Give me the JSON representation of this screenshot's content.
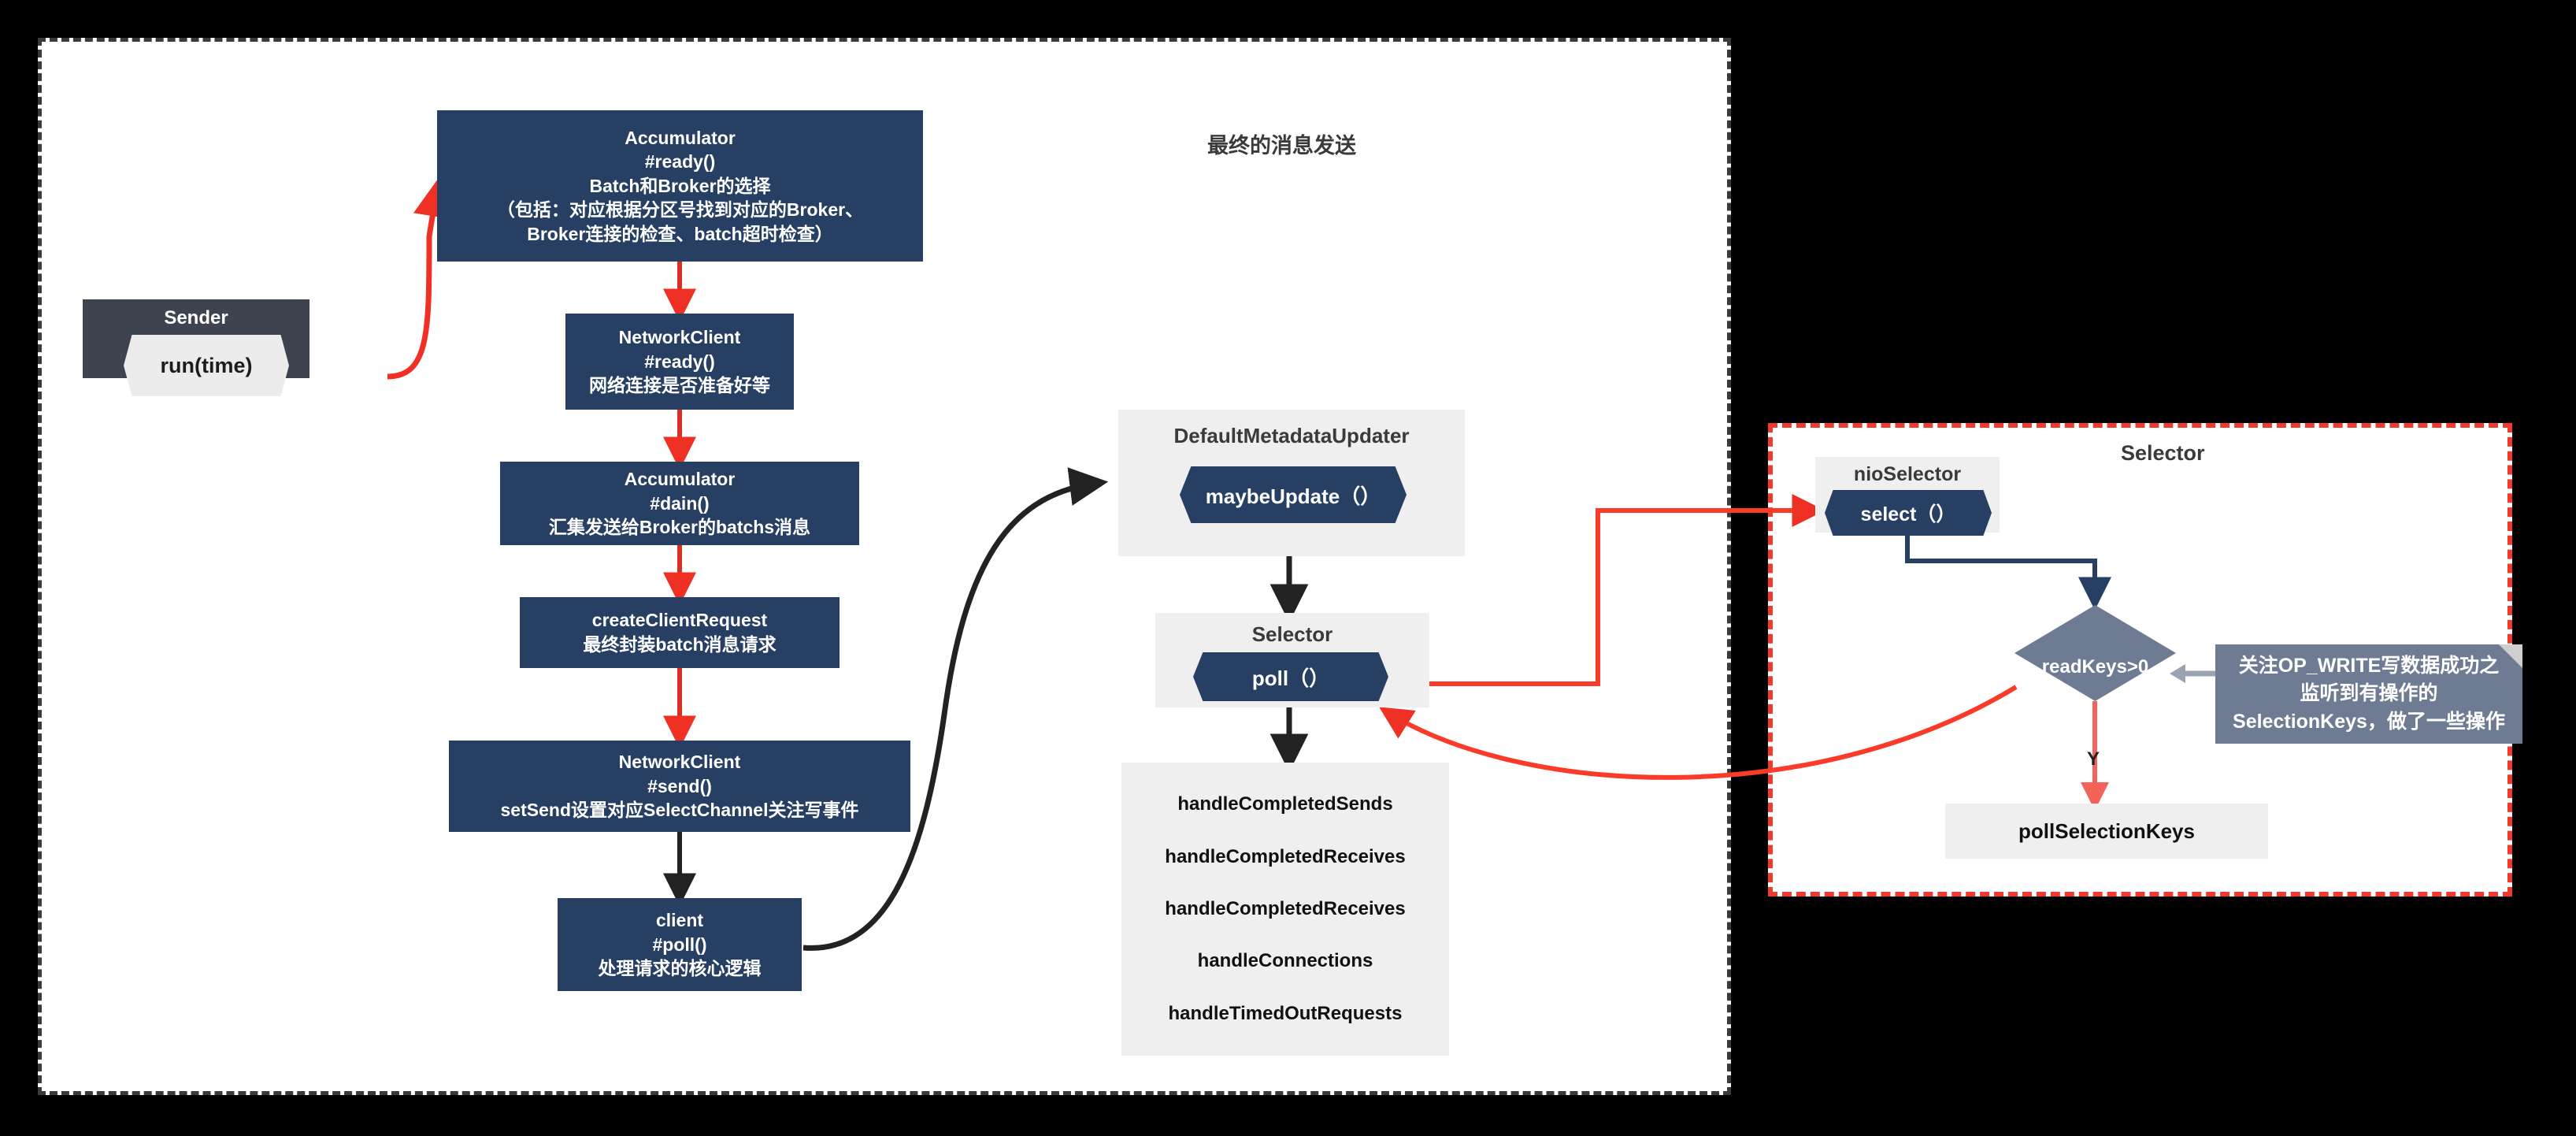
{
  "diagram": {
    "title": "最终的消息发送",
    "colors": {
      "node_fill": "#263f63",
      "sender_fill": "#3d434f",
      "group_fill": "#efefef",
      "diamond_fill": "#6e7b93",
      "note_fill": "#6e7b93",
      "red_arrow": "#ee3124",
      "black_arrow": "#222222",
      "panel_border_dark": "#3a3a3a",
      "panel_border_red": "#ef3b2d"
    }
  },
  "sender": {
    "title": "Sender",
    "call": "run(time)"
  },
  "flow": {
    "accumulator_ready": {
      "lines": [
        "Accumulator",
        "#ready()",
        "Batch和Broker的选择",
        "（包括：对应根据分区号找到对应的Broker、",
        "Broker连接的检查、batch超时检查）"
      ]
    },
    "networkclient_ready": {
      "lines": [
        "NetworkClient",
        "#ready()",
        "网络连接是否准备好等"
      ]
    },
    "accumulator_drain": {
      "lines": [
        "Accumulator",
        "#dain()",
        "汇集发送给Broker的batchs消息"
      ]
    },
    "create_client_request": {
      "lines": [
        "createClientRequest",
        "最终封装batch消息请求"
      ]
    },
    "networkclient_send": {
      "lines": [
        "NetworkClient",
        "#send()",
        "setSend设置对应SelectChannel关注写事件"
      ]
    },
    "client_poll": {
      "lines": [
        "client",
        "#poll()",
        "处理请求的核心逻辑"
      ]
    }
  },
  "metadata_updater": {
    "group_title": "DefaultMetadataUpdater",
    "call": "maybeUpdate（）"
  },
  "selector_mid": {
    "group_title": "Selector",
    "call": "poll（）"
  },
  "handlers": {
    "items": [
      "handleCompletedSends",
      "handleCompletedReceives",
      "handleCompletedReceives",
      "handleConnections",
      "handleTimedOutRequests"
    ]
  },
  "selector_panel": {
    "panel_title": "Selector",
    "nio_group_title": "nioSelector",
    "nio_call": "select（）",
    "decision": "readKeys>0",
    "decision_yes_label": "Y",
    "result_box": "pollSelectionKeys",
    "note_lines": [
      "关注OP_WRITE写数据成功之",
      "监听到有操作的",
      "SelectionKeys，做了一些操作"
    ]
  }
}
